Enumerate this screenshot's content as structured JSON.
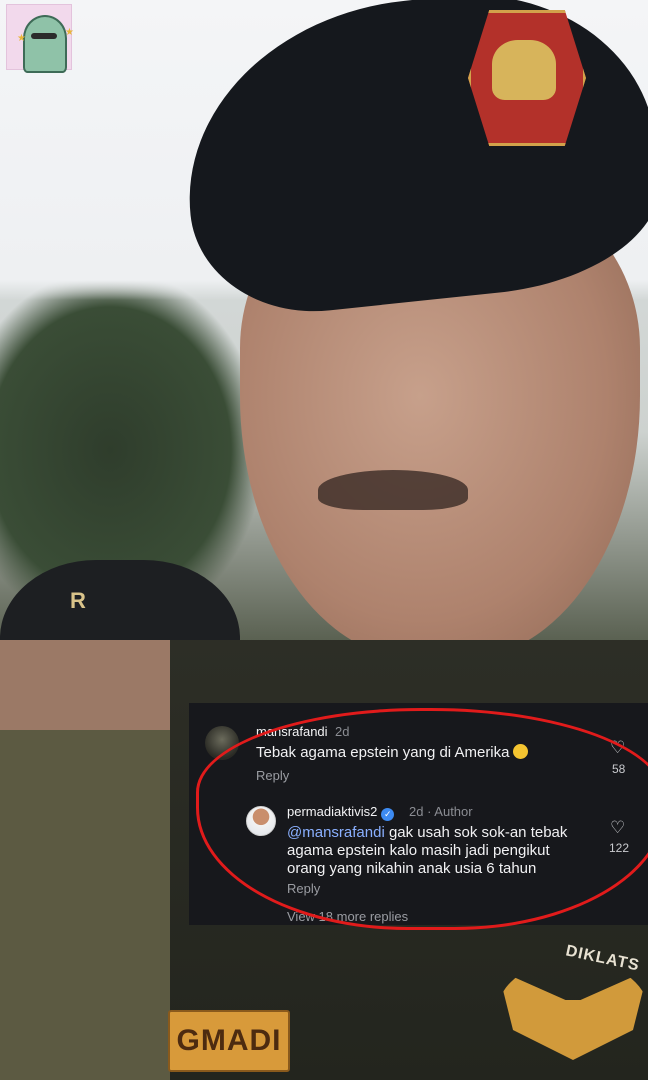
{
  "comment_1": {
    "username": "mansrafandi",
    "age": "2d",
    "text": "Tebak agama epstein yang di Amerika",
    "reply_label": "Reply",
    "like_count": "58"
  },
  "comment_2": {
    "username": "permadiaktivis2",
    "meta": "2d · Author",
    "mention": "@mansrafandi",
    "text": " gak usah sok sok-an tebak agama epstein kalo masih jadi pengikut orang yang nikahin anak usia 6 tahun",
    "reply_label": "Reply",
    "like_count": "122"
  },
  "view_more": "View 18 more replies",
  "photo": {
    "cap_text": "R",
    "name_patch": "GMADI",
    "shoulder_patch": "DIKLATS"
  },
  "icons": {
    "like": "heart-icon",
    "verified": "verified-badge-icon",
    "emoji": "laughing-emoji-icon"
  },
  "colors": {
    "panel_bg": "#17181c",
    "highlight": "#e11b1b",
    "mention": "#8ab0ff",
    "verified": "#3d8bf2"
  }
}
